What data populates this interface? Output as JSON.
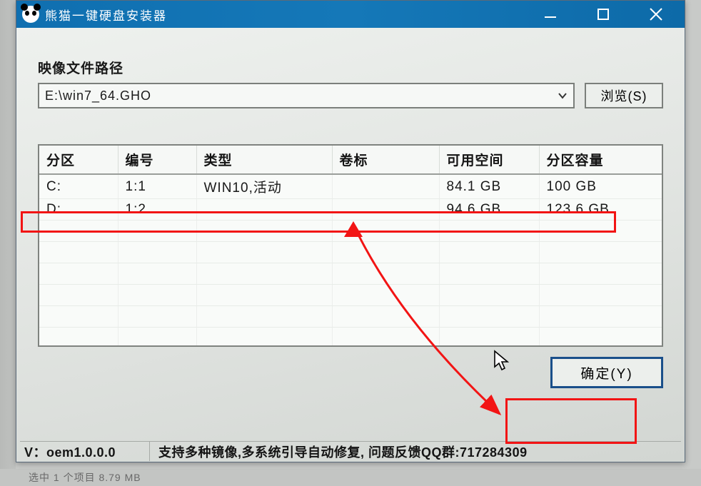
{
  "backdrop_bottom": "选中 1 个项目  8.79 MB",
  "titlebar": {
    "title": "熊猫一键硬盘安装器"
  },
  "form": {
    "path_label": "映像文件路径",
    "path_value": "E:\\win7_64.GHO",
    "browse_label": "浏览(S)"
  },
  "grid": {
    "headers": {
      "partition": "分区",
      "number": "编号",
      "type": "类型",
      "volume": "卷标",
      "free": "可用空间",
      "capacity": "分区容量"
    },
    "rows": [
      {
        "partition": "C:",
        "number": "1:1",
        "type": "WIN10,活动",
        "volume": "",
        "free": "84.1 GB",
        "capacity": "100 GB"
      },
      {
        "partition": "D:",
        "number": "1:2",
        "type": "",
        "volume": "",
        "free": "94.6 GB",
        "capacity": "123.6 GB"
      }
    ]
  },
  "actions": {
    "ok_label": "确定(Y)"
  },
  "status": {
    "version": "V：oem1.0.0.0",
    "message": "支持多种镜像,多系统引导自动修复, 问题反馈QQ群:717284309"
  }
}
